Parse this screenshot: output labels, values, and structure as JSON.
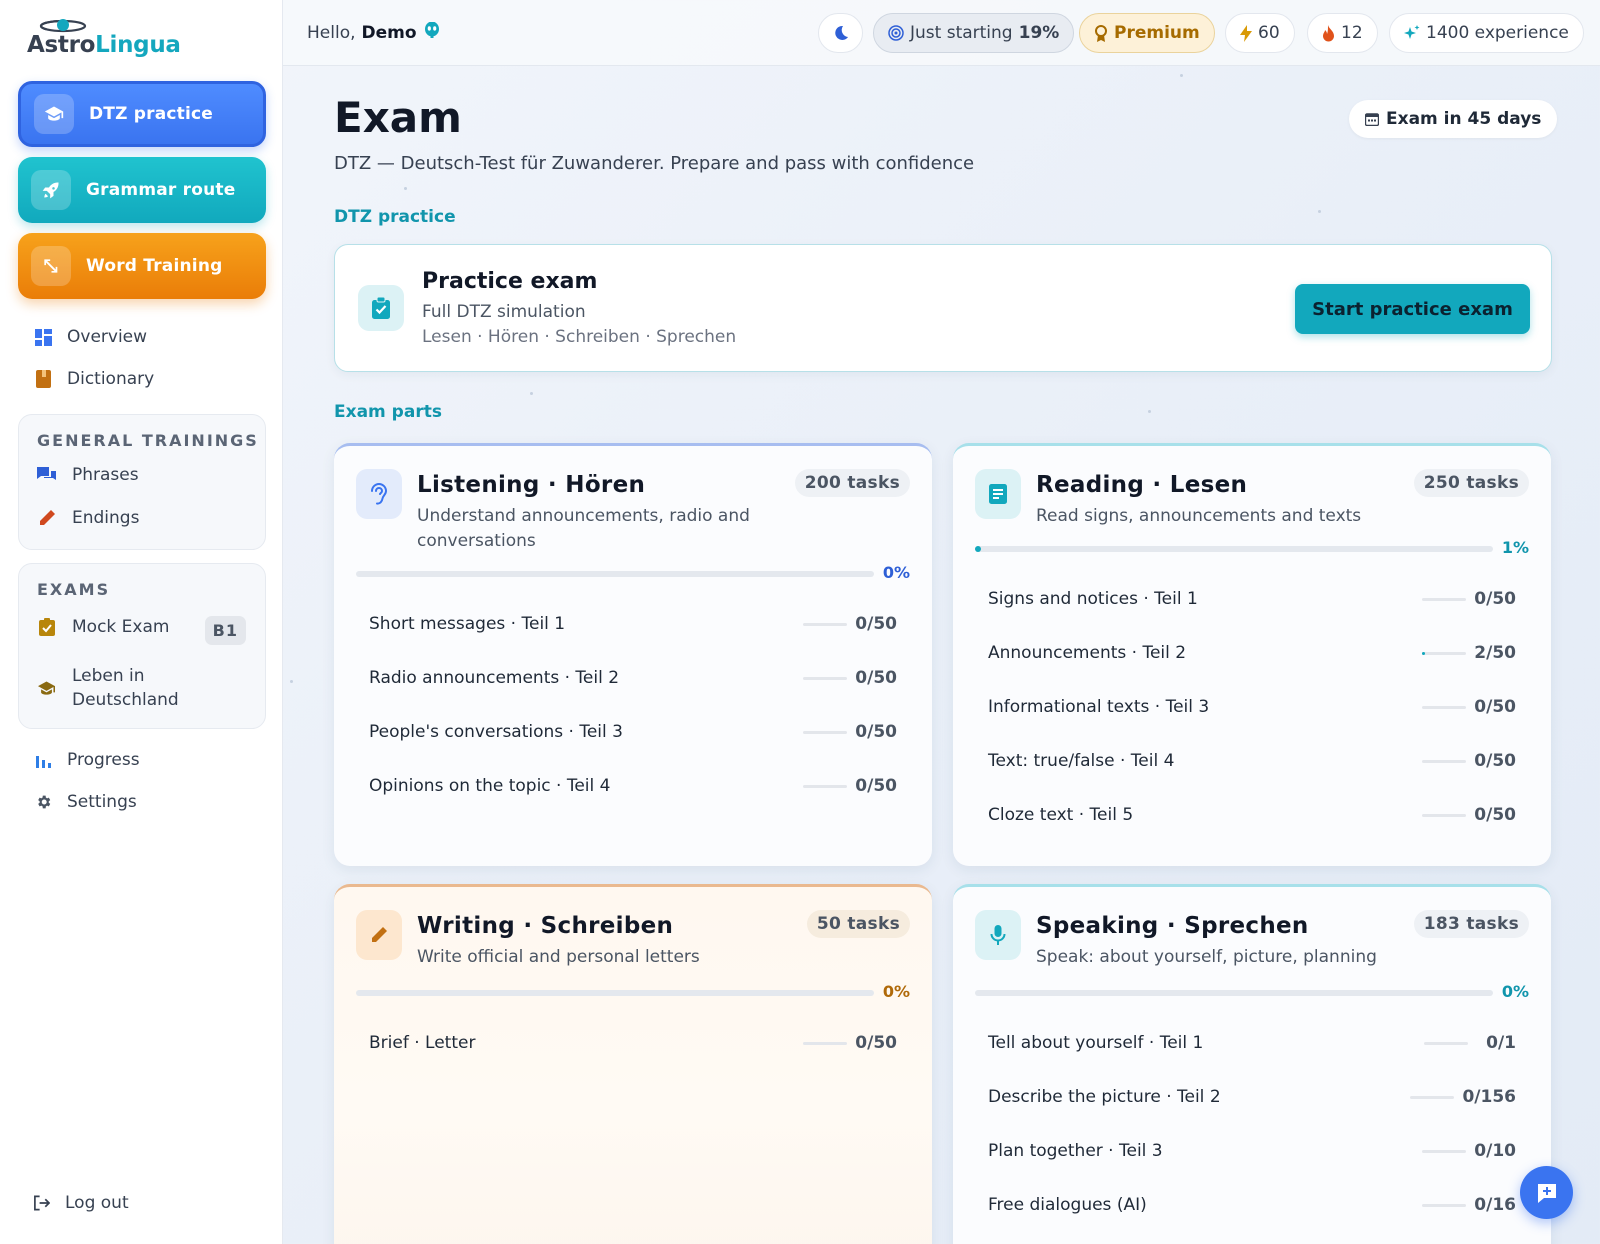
{
  "brand": {
    "part1": "Astro",
    "part2": "Lingua"
  },
  "nav": {
    "primary": [
      {
        "label": "DTZ practice",
        "icon": "graduation-cap-icon"
      },
      {
        "label": "Grammar route",
        "icon": "rocket-icon"
      },
      {
        "label": "Word Training",
        "icon": "expand-arrows-icon"
      }
    ],
    "links": [
      {
        "label": "Overview",
        "icon": "grid-icon"
      },
      {
        "label": "Dictionary",
        "icon": "book-icon"
      }
    ],
    "general_trainings": {
      "title": "GENERAL TRAININGS",
      "items": [
        {
          "label": "Phrases",
          "icon": "chat-bubbles-icon"
        },
        {
          "label": "Endings",
          "icon": "pencil-icon"
        }
      ]
    },
    "exams": {
      "title": "EXAMS",
      "items": [
        {
          "label": "Mock Exam",
          "badge": "B1",
          "icon": "clipboard-check-icon"
        },
        {
          "label_line1": "Leben in",
          "label_line2": "Deutschland",
          "icon": "graduation-cap-icon"
        }
      ]
    },
    "bottom_links": [
      {
        "label": "Progress",
        "icon": "bar-chart-icon"
      },
      {
        "label": "Settings",
        "icon": "gear-icon"
      }
    ],
    "logout": "Log out"
  },
  "topbar": {
    "greeting": "Hello,",
    "user": "Demo",
    "level_label": "Just starting",
    "level_pct": "19%",
    "premium": "Premium",
    "energy": "60",
    "streak": "12",
    "experience": "1400 experience"
  },
  "main": {
    "title": "Exam",
    "subtitle": "DTZ — Deutsch-Test für Zuwanderer. Prepare and pass with confidence",
    "exam_countdown": "Exam in 45 days",
    "section_practice": "DTZ practice",
    "practice": {
      "title": "Practice exam",
      "subtitle": "Full DTZ simulation",
      "parts": "Lesen · Hören · Schreiben · Sprechen",
      "button": "Start practice exam"
    },
    "section_parts": "Exam parts",
    "parts": [
      {
        "title": "Listening · Hören",
        "desc": "Understand announcements, radio and conversations",
        "tasks": "200 tasks",
        "pct_label": "0%",
        "progress": 0,
        "color": "#3a74f0",
        "items": [
          {
            "label": "Short messages · Teil 1",
            "count": "0/50",
            "progress": 0
          },
          {
            "label": "Radio announcements · Teil 2",
            "count": "0/50",
            "progress": 0
          },
          {
            "label": "People's conversations · Teil 3",
            "count": "0/50",
            "progress": 0
          },
          {
            "label": "Opinions on the topic · Teil 4",
            "count": "0/50",
            "progress": 0
          }
        ]
      },
      {
        "title": "Reading · Lesen",
        "desc": "Read signs, announcements and texts",
        "tasks": "250 tasks",
        "pct_label": "1%",
        "progress": 0.01,
        "color": "#12a8bd",
        "items": [
          {
            "label": "Signs and notices · Teil 1",
            "count": "0/50",
            "progress": 0
          },
          {
            "label": "Announcements · Teil 2",
            "count": "2/50",
            "progress": 0.04
          },
          {
            "label": "Informational texts · Teil 3",
            "count": "0/50",
            "progress": 0
          },
          {
            "label": "Text: true/false · Teil 4",
            "count": "0/50",
            "progress": 0
          },
          {
            "label": "Cloze text · Teil 5",
            "count": "0/50",
            "progress": 0
          }
        ]
      },
      {
        "title": "Writing · Schreiben",
        "desc": "Write official and personal letters",
        "tasks": "50 tasks",
        "pct_label": "0%",
        "progress": 0,
        "color": "#c27a12",
        "items": [
          {
            "label": "Brief · Letter",
            "count": "0/50",
            "progress": 0
          }
        ]
      },
      {
        "title": "Speaking · Sprechen",
        "desc": "Speak: about yourself, picture, planning",
        "tasks": "183 tasks",
        "pct_label": "0%",
        "progress": 0,
        "color": "#12a8bd",
        "items": [
          {
            "label": "Tell about yourself · Teil 1",
            "count": "0/1",
            "progress": 0
          },
          {
            "label": "Describe the picture · Teil 2",
            "count": "0/156",
            "progress": 0
          },
          {
            "label": "Plan together · Teil 3",
            "count": "0/10",
            "progress": 0
          },
          {
            "label": "Free dialogues (AI)",
            "count": "0/16",
            "progress": 0
          }
        ]
      }
    ]
  },
  "colors": {
    "accent_blue": "#3a74f0",
    "accent_teal": "#12a8bd",
    "accent_orange": "#ea7d08"
  }
}
